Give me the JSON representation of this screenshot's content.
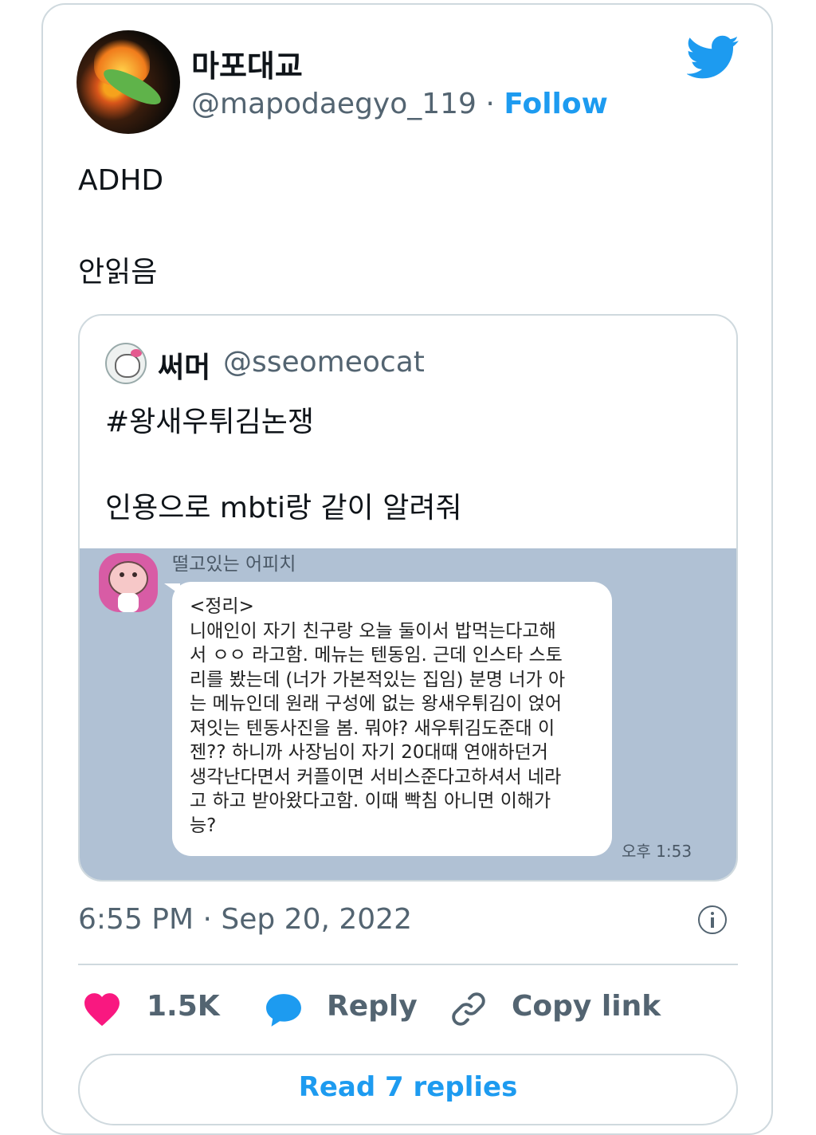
{
  "author": {
    "display_name": "마포대교",
    "handle": "@mapodaegyo_119",
    "separator": "·",
    "follow_label": "Follow"
  },
  "tweet": {
    "lines": [
      "ADHD",
      "안읽음"
    ]
  },
  "quoted": {
    "display_name": "써머",
    "handle": "@sseomeocat",
    "lines": [
      "#왕새우튀김논쟁",
      "인용으로 mbti랑 같이 알려줘"
    ],
    "chat": {
      "sender": "떨고있는 어피치",
      "message": "<정리>\n니애인이 자기 친구랑 오늘 둘이서 밥먹는다고해\n서 ㅇㅇ 라고함. 메뉴는 텐동임. 근데 인스타 스토\n리를 봤는데 (너가 가본적있는 집임) 분명 너가 아\n는 메뉴인데 원래 구성에 없는 왕새우튀김이 얹어\n져잇는 텐동사진을 봄. 뭐야? 새우튀김도준대 이\n젠?? 하니까 사장님이 자기 20대때 연애하던거\n생각난다면서 커플이면 서비스준다고하셔서 네라\n고 하고 받아왔다고함. 이때 빡침 아니면 이해가\n능?",
      "time": "오후 1:53"
    }
  },
  "timestamp": "6:55 PM · Sep 20, 2022",
  "actions": {
    "likes": "1.5K",
    "reply_label": "Reply",
    "copy_link_label": "Copy link"
  },
  "read_replies_label": "Read 7 replies",
  "colors": {
    "accent": "#1d9bf0",
    "like": "#f91880",
    "muted": "#536471",
    "chat_bg": "#b0c1d4"
  }
}
